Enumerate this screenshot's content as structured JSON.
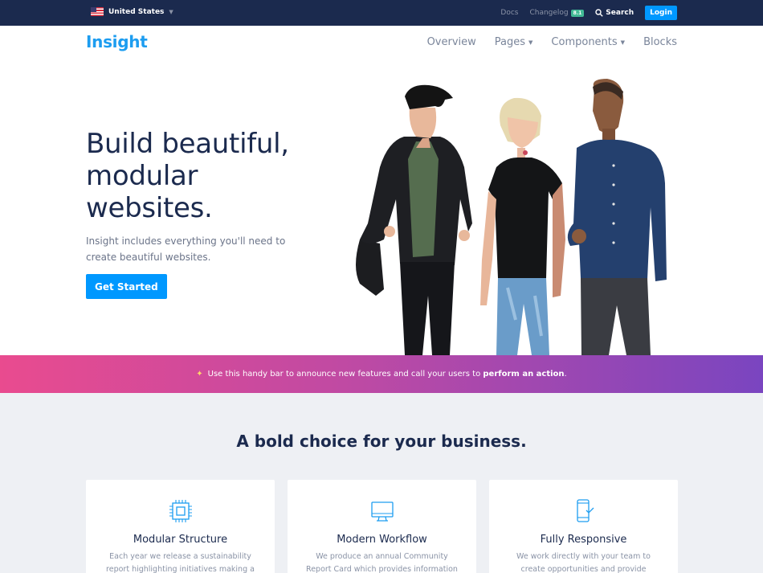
{
  "utility": {
    "country": "United States",
    "links": {
      "docs": "Docs",
      "changelog": "Changelog",
      "changelog_badge": "8.1",
      "search": "Search",
      "login": "Login"
    }
  },
  "nav": {
    "brand": "Insight",
    "items": [
      {
        "label": "Overview",
        "has_caret": false
      },
      {
        "label": "Pages",
        "has_caret": true
      },
      {
        "label": "Components",
        "has_caret": true
      },
      {
        "label": "Blocks",
        "has_caret": false
      }
    ]
  },
  "hero": {
    "title": "Build beautiful, modular websites.",
    "subtitle": "Insight includes everything you'll need to create beautiful websites.",
    "cta": "Get Started"
  },
  "announcement": {
    "text": "Use this handy bar to announce new features and call your users to",
    "link": "perform an action",
    "suffix": "."
  },
  "features": {
    "title": "A bold choice for your business.",
    "cards": [
      {
        "icon": "chip-icon",
        "title": "Modular Structure",
        "text": "Each year we release a sustainability report highlighting initiatives making a"
      },
      {
        "icon": "monitor-icon",
        "title": "Modern Workflow",
        "text": "We produce an annual Community Report Card which provides information on our"
      },
      {
        "icon": "mobile-icon",
        "title": "Fully Responsive",
        "text": "We work directly with your team to create opportunities and provide marketing"
      }
    ]
  },
  "colors": {
    "primary": "#0098ff",
    "navy": "#1b2a4e",
    "brand": "#1d9df0",
    "gradient_start": "#e94b8f",
    "gradient_end": "#7a45c0"
  }
}
